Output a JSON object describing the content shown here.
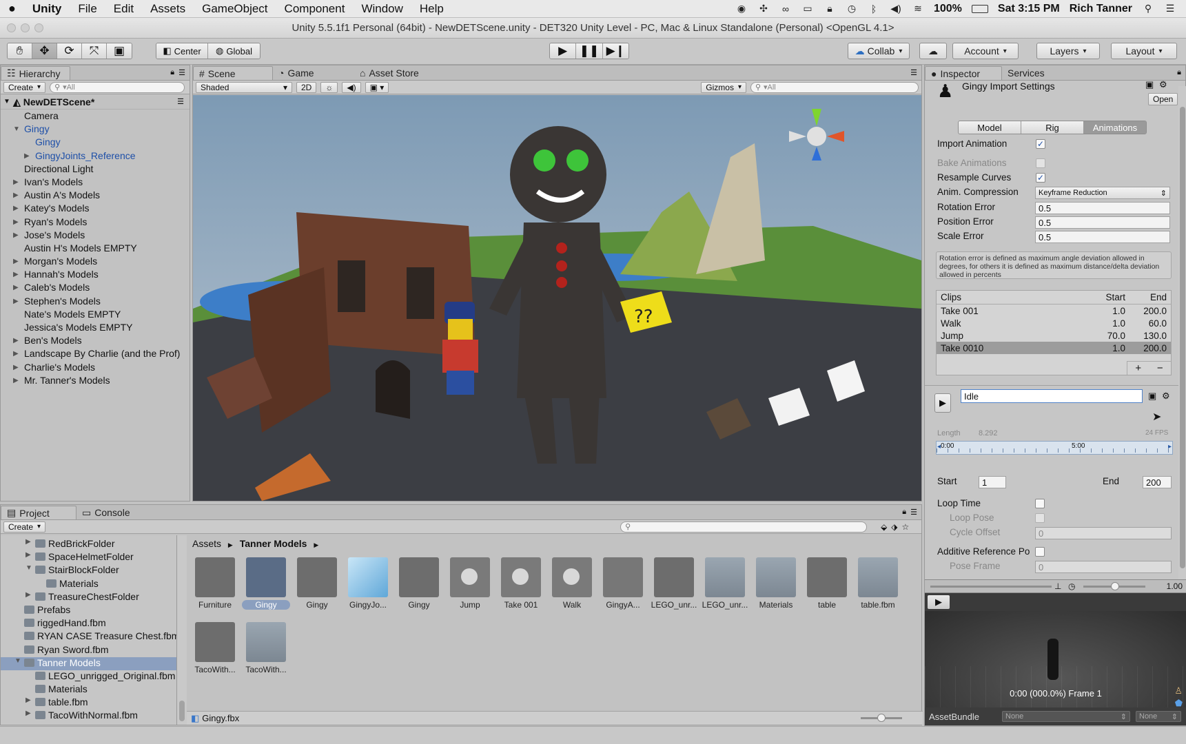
{
  "menubar": {
    "apple": "",
    "app": "Unity",
    "items": [
      "File",
      "Edit",
      "Assets",
      "GameObject",
      "Component",
      "Window",
      "Help"
    ],
    "battery": "100%",
    "clock": "Sat 3:15 PM",
    "user": "Rich Tanner"
  },
  "title": "Unity 5.5.1f1 Personal (64bit) - NewDETScene.unity - DET320 Unity Level - PC, Mac & Linux Standalone (Personal) <OpenGL 4.1>",
  "toolbar": {
    "pivot": "Center",
    "space": "Global",
    "collab": "Collab",
    "account": "Account",
    "layers": "Layers",
    "layout": "Layout"
  },
  "hierarchy": {
    "tab": "Hierarchy",
    "create": "Create",
    "search": "▾All",
    "scene": "NewDETScene*",
    "items": [
      {
        "label": "Camera",
        "indent": 1,
        "arrow": "",
        "blue": false
      },
      {
        "label": "Gingy",
        "indent": 1,
        "arrow": "▼",
        "blue": true
      },
      {
        "label": "Gingy",
        "indent": 2,
        "arrow": "",
        "blue": true
      },
      {
        "label": "GingyJoints_Reference",
        "indent": 2,
        "arrow": "▶",
        "blue": true
      },
      {
        "label": "Directional Light",
        "indent": 1,
        "arrow": "",
        "blue": false
      },
      {
        "label": "Ivan's Models",
        "indent": 1,
        "arrow": "▶",
        "blue": false
      },
      {
        "label": "Austin A's Models",
        "indent": 1,
        "arrow": "▶",
        "blue": false
      },
      {
        "label": "Katey's Models",
        "indent": 1,
        "arrow": "▶",
        "blue": false
      },
      {
        "label": "Ryan's Models",
        "indent": 1,
        "arrow": "▶",
        "blue": false
      },
      {
        "label": "Jose's Models",
        "indent": 1,
        "arrow": "▶",
        "blue": false
      },
      {
        "label": "Austin H's Models EMPTY",
        "indent": 1,
        "arrow": "",
        "blue": false
      },
      {
        "label": "Morgan's Models",
        "indent": 1,
        "arrow": "▶",
        "blue": false
      },
      {
        "label": "Hannah's Models",
        "indent": 1,
        "arrow": "▶",
        "blue": false
      },
      {
        "label": "Caleb's Models",
        "indent": 1,
        "arrow": "▶",
        "blue": false
      },
      {
        "label": "Stephen's Models",
        "indent": 1,
        "arrow": "▶",
        "blue": false
      },
      {
        "label": "Nate's Models EMPTY",
        "indent": 1,
        "arrow": "",
        "blue": false
      },
      {
        "label": "Jessica's Models EMPTY",
        "indent": 1,
        "arrow": "",
        "blue": false
      },
      {
        "label": "Ben's Models",
        "indent": 1,
        "arrow": "▶",
        "blue": false
      },
      {
        "label": "Landscape By Charlie (and the Prof)",
        "indent": 1,
        "arrow": "▶",
        "blue": false
      },
      {
        "label": "Charlie's Models",
        "indent": 1,
        "arrow": "▶",
        "blue": false
      },
      {
        "label": "Mr. Tanner's Models",
        "indent": 1,
        "arrow": "▶",
        "blue": false
      }
    ]
  },
  "scene": {
    "tabs": [
      "Scene",
      "Game",
      "Asset Store"
    ],
    "shading": "Shaded",
    "mode2d": "2D",
    "gizmos": "Gizmos",
    "search": "▾All"
  },
  "project": {
    "tabs": [
      "Project",
      "Console"
    ],
    "create": "Create",
    "breadcrumb": [
      "Assets",
      "Tanner Models"
    ],
    "selected_file": "Gingy.fbx",
    "tree": [
      {
        "label": "RedBrickFolder",
        "indent": 2,
        "arrow": "▶",
        "sel": false
      },
      {
        "label": "SpaceHelmetFolder",
        "indent": 2,
        "arrow": "▶",
        "sel": false
      },
      {
        "label": "StairBlockFolder",
        "indent": 2,
        "arrow": "▼",
        "sel": false
      },
      {
        "label": "Materials",
        "indent": 3,
        "arrow": "",
        "sel": false
      },
      {
        "label": "TreasureChestFolder",
        "indent": 2,
        "arrow": "▶",
        "sel": false
      },
      {
        "label": "Prefabs",
        "indent": 1,
        "arrow": "",
        "sel": false
      },
      {
        "label": "riggedHand.fbm",
        "indent": 1,
        "arrow": "",
        "sel": false
      },
      {
        "label": "RYAN CASE Treasure Chest.fbm",
        "indent": 1,
        "arrow": "",
        "sel": false
      },
      {
        "label": "Ryan Sword.fbm",
        "indent": 1,
        "arrow": "",
        "sel": false
      },
      {
        "label": "Tanner Models",
        "indent": 1,
        "arrow": "▼",
        "sel": true
      },
      {
        "label": "LEGO_unrigged_Original.fbm",
        "indent": 2,
        "arrow": "",
        "sel": false
      },
      {
        "label": "Materials",
        "indent": 2,
        "arrow": "",
        "sel": false
      },
      {
        "label": "table.fbm",
        "indent": 2,
        "arrow": "▶",
        "sel": false
      },
      {
        "label": "TacoWithNormal.fbm",
        "indent": 2,
        "arrow": "▶",
        "sel": false
      }
    ],
    "assets": [
      {
        "label": "Furniture",
        "kind": "model"
      },
      {
        "label": "Gingy",
        "kind": "model-sel"
      },
      {
        "label": "Gingy",
        "kind": "model"
      },
      {
        "label": "GingyJo...",
        "kind": "mesh"
      },
      {
        "label": "Gingy",
        "kind": "model"
      },
      {
        "label": "Jump",
        "kind": "clip"
      },
      {
        "label": "Take 001",
        "kind": "clip"
      },
      {
        "label": "Walk",
        "kind": "clip"
      },
      {
        "label": "GingyA...",
        "kind": "avatar"
      },
      {
        "label": "LEGO_unr...",
        "kind": "model"
      },
      {
        "label": "LEGO_unr...",
        "kind": "folder"
      },
      {
        "label": "Materials",
        "kind": "folder"
      },
      {
        "label": "table",
        "kind": "model"
      },
      {
        "label": "table.fbm",
        "kind": "folder"
      },
      {
        "label": "TacoWith...",
        "kind": "model"
      },
      {
        "label": "TacoWith...",
        "kind": "folder"
      }
    ]
  },
  "inspector": {
    "tabs": [
      "Inspector",
      "Services"
    ],
    "title": "Gingy Import Settings",
    "open": "Open",
    "subtabs": [
      "Model",
      "Rig",
      "Animations"
    ],
    "import_animation": "Import Animation",
    "bake_animations": "Bake Animations",
    "resample_curves": "Resample Curves",
    "anim_compression": "Anim. Compression",
    "anim_compression_value": "Keyframe Reduction",
    "rotation_error": "Rotation Error",
    "rotation_error_value": "0.5",
    "position_error": "Position Error",
    "position_error_value": "0.5",
    "scale_error": "Scale Error",
    "scale_error_value": "0.5",
    "help": "Rotation error is defined as maximum angle deviation allowed in degrees, for others it is defined as maximum distance/delta deviation allowed in percents",
    "clips_header": [
      "Clips",
      "Start",
      "End"
    ],
    "clips": [
      {
        "name": "Take 001",
        "start": "1.0",
        "end": "200.0"
      },
      {
        "name": "Walk",
        "start": "1.0",
        "end": "60.0"
      },
      {
        "name": "Jump",
        "start": "70.0",
        "end": "130.0"
      },
      {
        "name": "Take 0010",
        "start": "1.0",
        "end": "200.0"
      }
    ],
    "clip_name": "Idle",
    "length_label": "Length",
    "length_value": "8.292",
    "fps": "24 FPS",
    "tl_start": "0:00",
    "tl_mid": "5:00",
    "start_label": "Start",
    "start_value": "1",
    "end_label": "End",
    "end_value": "200",
    "loop_time": "Loop Time",
    "loop_pose": "Loop Pose",
    "cycle_offset": "Cycle Offset",
    "cycle_offset_value": "0",
    "additive": "Additive Reference Po",
    "pose_frame": "Pose Frame",
    "pose_frame_value": "0",
    "preview_speed": "1.00",
    "preview_time": "0:00 (000.0%) Frame 1",
    "assetbundle": "AssetBundle",
    "bundle_value": "None",
    "bundle_variant": "None"
  }
}
